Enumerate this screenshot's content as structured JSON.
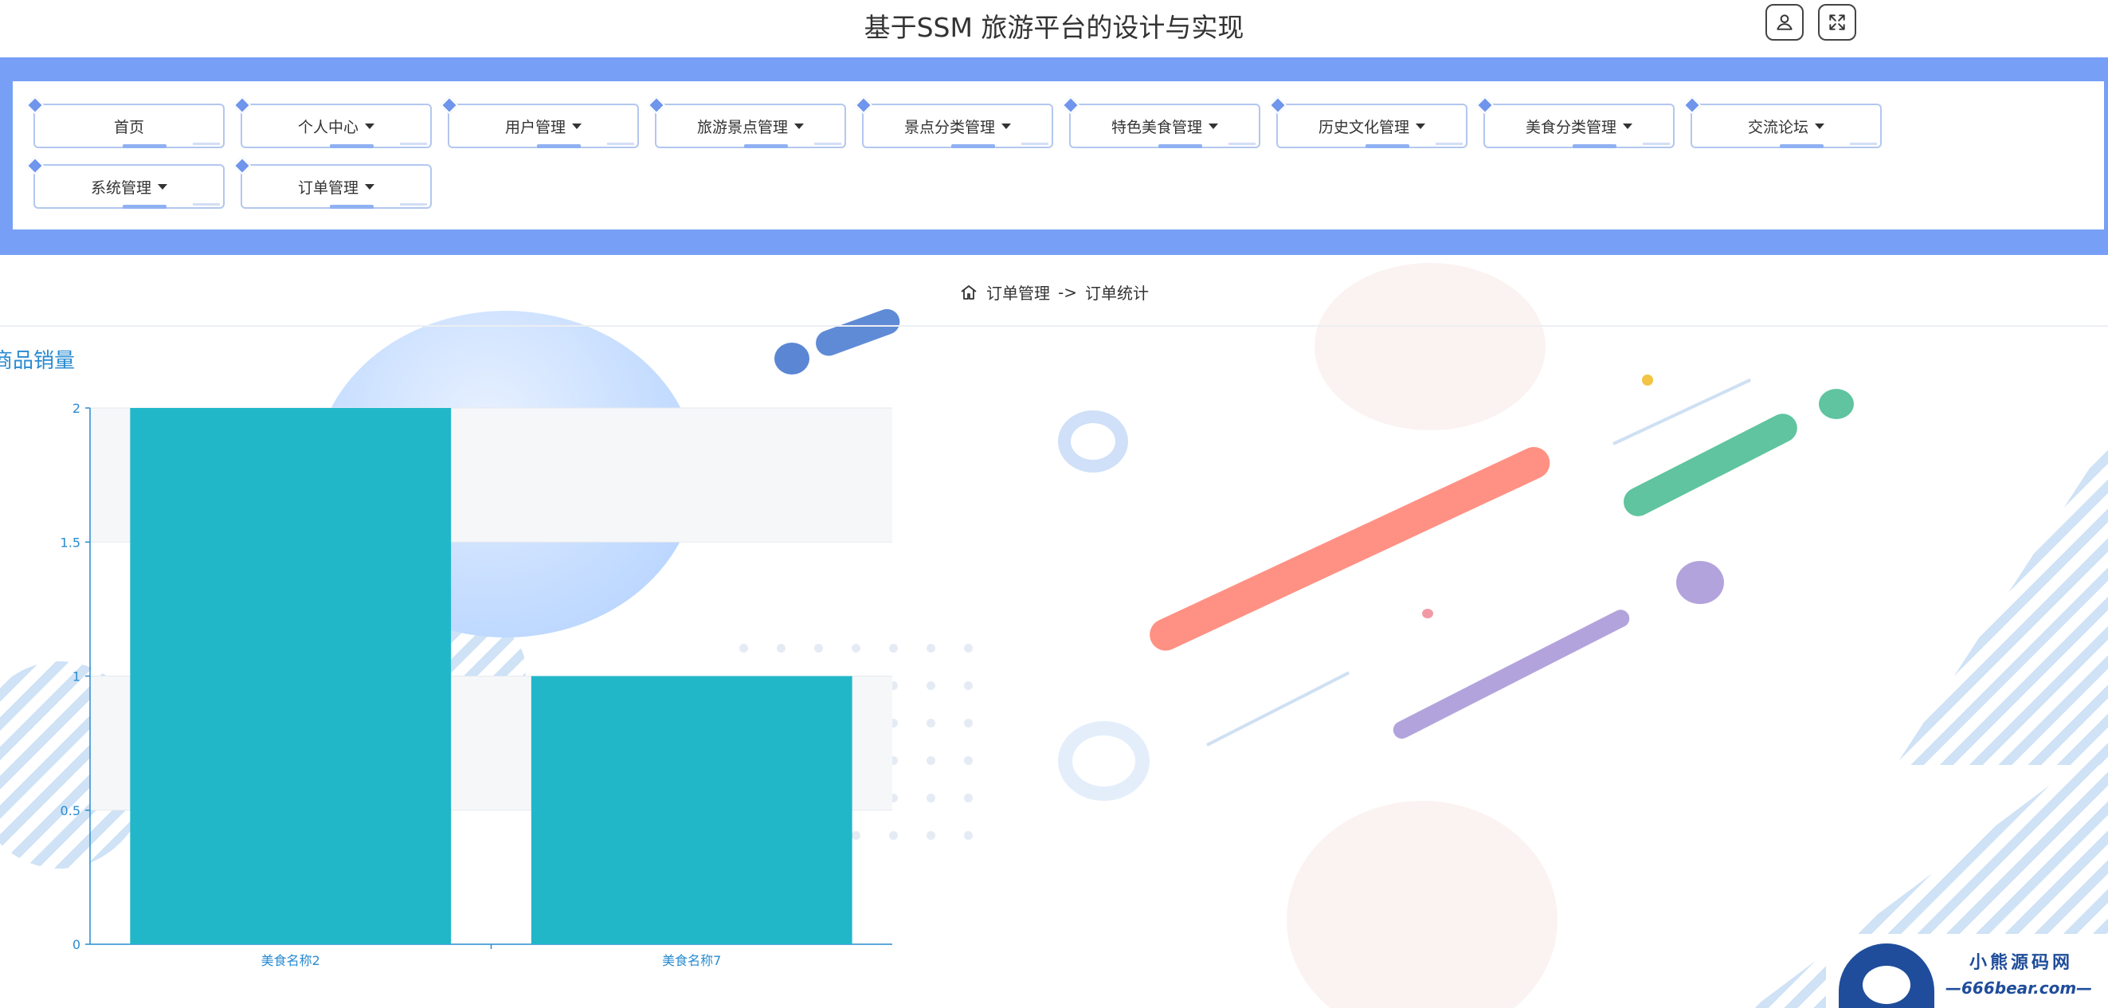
{
  "header": {
    "title": "基于SSM 旅游平台的设计与实现",
    "buttons": [
      {
        "icon": "user-icon"
      },
      {
        "icon": "fullscreen-icon"
      }
    ]
  },
  "nav": {
    "items": [
      {
        "label": "首页",
        "dropdown": false
      },
      {
        "label": "个人中心",
        "dropdown": true
      },
      {
        "label": "用户管理",
        "dropdown": true
      },
      {
        "label": "旅游景点管理",
        "dropdown": true
      },
      {
        "label": "景点分类管理",
        "dropdown": true
      },
      {
        "label": "特色美食管理",
        "dropdown": true
      },
      {
        "label": "历史文化管理",
        "dropdown": true
      },
      {
        "label": "美食分类管理",
        "dropdown": true
      },
      {
        "label": "交流论坛",
        "dropdown": true
      },
      {
        "label": "系统管理",
        "dropdown": true
      },
      {
        "label": "订单管理",
        "dropdown": true
      }
    ]
  },
  "breadcrumb": {
    "icon": "home-icon",
    "parent": "订单管理",
    "separator": "->",
    "current": "订单统计"
  },
  "chart_title": "商品销量",
  "chart_data": {
    "type": "bar",
    "title": "商品销量",
    "categories": [
      "美食名称2",
      "美食名称7"
    ],
    "values": [
      2,
      1
    ],
    "ylim": [
      0,
      2
    ],
    "yticks": [
      "0",
      "0.5",
      "1",
      "1.5",
      "2"
    ],
    "xlabel": "",
    "ylabel": "",
    "grid": true,
    "colors": {
      "bar": "#21b7c9",
      "axis": "#2a8bd0",
      "band": "#f6f7f9"
    }
  },
  "watermark": {
    "name": "小熊源码网",
    "url": "—666bear.com—"
  },
  "colors": {
    "nav_bg": "#779ff5",
    "accent": "#2a8bd0"
  }
}
